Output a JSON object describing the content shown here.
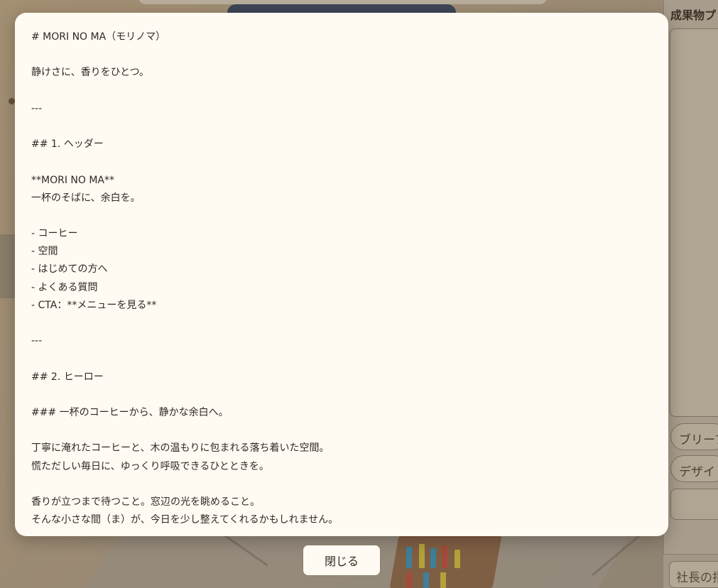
{
  "modal": {
    "lines": [
      "# MORI NO MA（モリノマ）",
      "",
      "静けさに、香りをひとつ。",
      "",
      "---",
      "",
      "## 1. ヘッダー",
      "",
      "**MORI NO MA**",
      "一杯のそばに、余白を。",
      "",
      "- コーヒー",
      "- 空間",
      "- はじめての方へ",
      "- よくある質問",
      "- CTA：**メニューを見る**",
      "",
      "---",
      "",
      "## 2. ヒーロー",
      "",
      "### 一杯のコーヒーから、静かな余白へ。",
      "",
      "丁寧に淹れたコーヒーと、木の温もりに包まれる落ち着いた空間。",
      "慌ただしい毎日に、ゆっくり呼吸できるひとときを。",
      "",
      "香りが立つまで待つこと。窓辺の光を眺めること。",
      "そんな小さな間（ま）が、今日を少し整えてくれるかもしれません。"
    ],
    "close_label": "閉じる"
  },
  "side_panel": {
    "title": "成果物プ",
    "brief_button": "ブリーフ",
    "design_button": "デザイ",
    "chat_placeholder": "社長の指"
  },
  "colors": {
    "modal_bg": "#fffbf2",
    "overlay": "#9a8870",
    "text": "#2f2a24"
  }
}
